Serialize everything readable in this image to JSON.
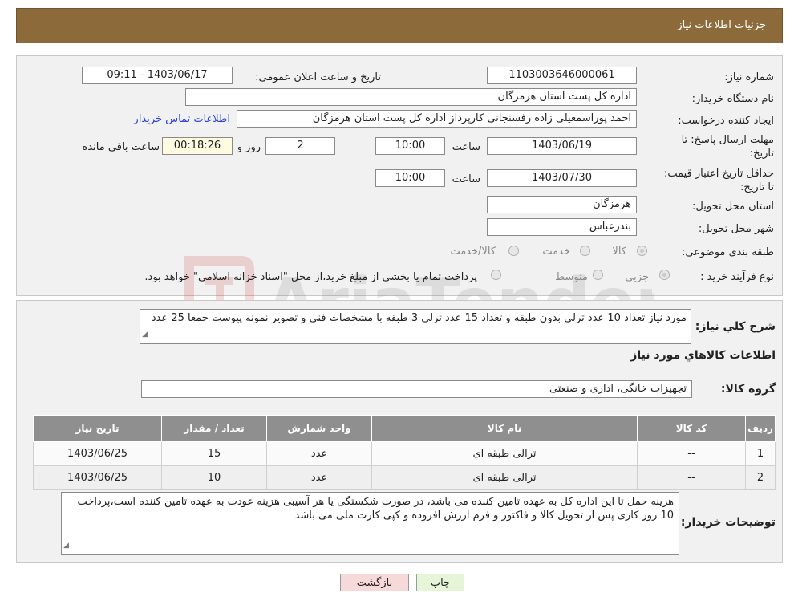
{
  "header": {
    "title": "جزئیات اطلاعات نیاز"
  },
  "form": {
    "need_number_label": "شماره نیاز:",
    "need_number": "1103003646000061",
    "announce_label": "تاریخ و ساعت اعلان عمومی:",
    "announce_value": "1403/06/17 - 09:11",
    "buyer_org_label": "نام دستگاه خریدار:",
    "buyer_org": "اداره کل پست استان هرمزگان",
    "requester_label": "ایجاد کننده درخواست:",
    "requester": "احمد پوراسمعیلی زاده رفسنجانی کارپرداز اداره کل پست استان هرمزگان",
    "contact_link": "اطلاعات تماس خریدار",
    "deadline_label": "مهلت ارسال پاسخ: تا تاریخ:",
    "deadline_date": "1403/06/19",
    "time_label": "ساعت",
    "deadline_time": "10:00",
    "days_value": "2",
    "days_label": "روز و",
    "remaining_time": "00:18:26",
    "remaining_label": "ساعت باقي مانده",
    "validity_label": "حداقل تاریخ اعتبار قیمت: تا تاریخ:",
    "validity_date": "1403/07/30",
    "validity_time": "10:00",
    "province_label": "استان محل تحویل:",
    "province": "هرمزگان",
    "city_label": "شهر محل تحویل:",
    "city": "بندرعباس",
    "category_label": "طبقه بندی موضوعی:",
    "category_options": [
      "کالا",
      "خدمت",
      "کالا/خدمت"
    ],
    "purchase_type_label": "نوع فرآیند خرید :",
    "purchase_options": [
      "جزیي",
      "متوسط"
    ],
    "purchase_note": "پرداخت تمام یا بخشی از مبلغ خرید،از محل \"اسناد خزانه اسلامی\" خواهد بود."
  },
  "details": {
    "summary_label": "شرح کلي نیاز:",
    "summary_text": "مورد نیاز تعداد 10 عدد ترلی بدون طبقه و تعداد 15 عدد ترلی 3 طبقه با مشخصات فنی و تصویر نمونه پیوست جمعا 25 عدد",
    "goods_info_title": "اطلاعات کالاهاي مورد نیاز",
    "goods_group_label": "گروه کالا:",
    "goods_group": "تجهیزات خانگی، اداری و صنعتی",
    "table": {
      "headers": [
        "ردیف",
        "کد کالا",
        "نام کالا",
        "واحد شمارش",
        "تعداد / مقدار",
        "تاریخ نیاز"
      ],
      "rows": [
        [
          "1",
          "--",
          "ترالی طبقه ای",
          "عدد",
          "15",
          "1403/06/25"
        ],
        [
          "2",
          "--",
          "ترالی طبقه ای",
          "عدد",
          "10",
          "1403/06/25"
        ]
      ]
    },
    "buyer_notes_label": "توضیحات خریدار:",
    "buyer_notes": "هزینه حمل تا این اداره کل به عهده تامین کننده می باشد، در صورت شکستگی یا هر آسیبی هزینه عودت به عهده تامین کننده است،پرداخت 10 روز کاری پس از تحویل کالا و فاکتور و فرم ارزش افزوده و کپی کارت ملی می باشد"
  },
  "buttons": {
    "print": "چاپ",
    "back": "بازگشت"
  },
  "watermark": {
    "text": "AriaTender.neT"
  },
  "colors": {
    "header": "#8c6a3a",
    "table_header": "#8f8f8f",
    "link": "#2a3fd6",
    "back_button": "#f8d9d9",
    "print_button": "#e6f5d8"
  }
}
